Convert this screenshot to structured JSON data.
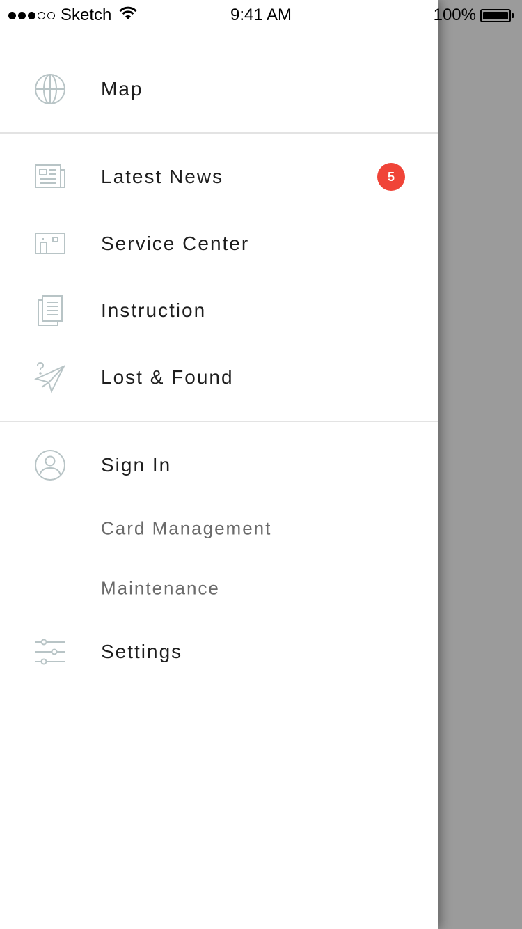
{
  "status_bar": {
    "carrier": "Sketch",
    "time": "9:41 AM",
    "battery": "100%",
    "signal_bars_filled": 3,
    "signal_bars_total": 5
  },
  "menu": {
    "map": {
      "label": "Map",
      "icon": "globe-icon"
    },
    "latest_news": {
      "label": "Latest News",
      "icon": "newspaper-icon",
      "badge": "5"
    },
    "service_center": {
      "label": "Service Center",
      "icon": "building-icon"
    },
    "instruction": {
      "label": "Instruction",
      "icon": "document-icon"
    },
    "lost_found": {
      "label": "Lost & Found",
      "icon": "paper-plane-question-icon"
    },
    "sign_in": {
      "label": "Sign In",
      "icon": "user-icon"
    },
    "card_management": {
      "label": "Card Management"
    },
    "maintenance": {
      "label": "Maintenance"
    },
    "settings": {
      "label": "Settings",
      "icon": "sliders-icon"
    }
  },
  "colors": {
    "badge": "#f04438",
    "icon_stroke": "#b8c4c6",
    "overlay": "#9b9b9b"
  }
}
